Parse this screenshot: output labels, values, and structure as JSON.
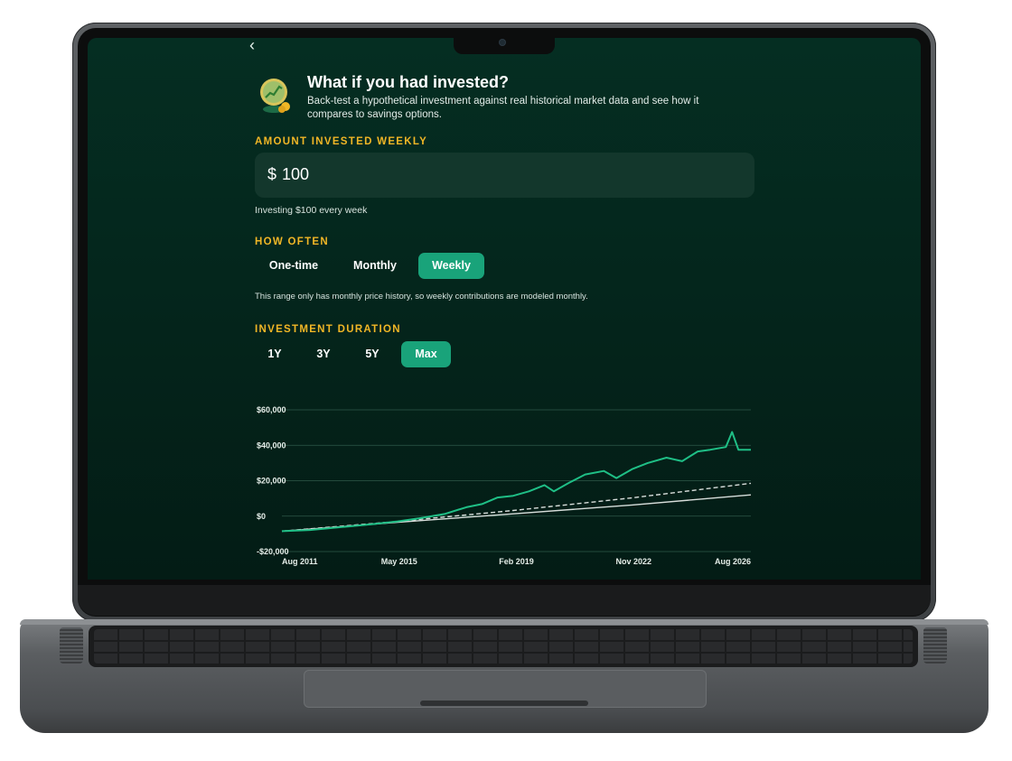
{
  "header": {
    "back_icon": "chevron-left-icon",
    "title": "What if you had invested?",
    "subtitle": "Back-test a hypothetical investment against real historical market data and see how it compares to savings options."
  },
  "amount": {
    "label": "AMOUNT INVESTED WEEKLY",
    "currency": "$",
    "value": "100",
    "helper": "Investing $100 every week"
  },
  "frequency": {
    "label": "HOW OFTEN",
    "options": [
      "One-time",
      "Monthly",
      "Weekly"
    ],
    "selected": "Weekly",
    "note": "This range only has monthly price history, so weekly contributions are modeled monthly."
  },
  "duration": {
    "label": "INVESTMENT DURATION",
    "options": [
      "1Y",
      "3Y",
      "5Y",
      "Max"
    ],
    "selected": "Max"
  },
  "colors": {
    "accent": "#19a37a",
    "section_label": "#f1b626",
    "investment_line": "#1fbf86",
    "background": "#042619"
  },
  "chart_data": {
    "type": "line",
    "x_tick_labels": [
      "Aug 2011",
      "May 2015",
      "Feb 2019",
      "Nov 2022",
      "Aug 2026"
    ],
    "y_tick_labels": [
      "$60,000",
      "$40,000",
      "$20,000",
      "$0",
      "-$20,000"
    ],
    "ylim": [
      -20000,
      60000
    ],
    "xlim": [
      2011.6,
      2026.6
    ],
    "grid": true,
    "series": [
      {
        "style": "solid-green",
        "x": [
          2011.6,
          2012.5,
          2013.5,
          2014.5,
          2015.3,
          2016.0,
          2016.8,
          2017.5,
          2018.0,
          2018.5,
          2019.0,
          2019.5,
          2020.0,
          2020.3,
          2020.8,
          2021.3,
          2021.9,
          2022.3,
          2022.8,
          2023.3,
          2023.9,
          2024.4,
          2024.9,
          2025.3,
          2025.8,
          2026.0,
          2026.2,
          2026.6
        ],
        "y": [
          -8500,
          -7800,
          -6200,
          -4500,
          -3000,
          -1200,
          1200,
          5000,
          6800,
          10500,
          11500,
          14000,
          17500,
          14000,
          19000,
          23500,
          25500,
          21500,
          26500,
          30000,
          33000,
          31000,
          36500,
          37500,
          39000,
          47500,
          37500,
          37500
        ]
      },
      {
        "style": "dashed-white",
        "x": [
          2011.6,
          2015.3,
          2019.0,
          2022.8,
          2026.6
        ],
        "y": [
          -8500,
          -3000,
          3200,
          10300,
          18500
        ]
      },
      {
        "style": "solid-white",
        "x": [
          2011.6,
          2015.3,
          2019.0,
          2022.8,
          2026.6
        ],
        "y": [
          -8500,
          -3500,
          1300,
          6300,
          12000
        ]
      }
    ]
  }
}
